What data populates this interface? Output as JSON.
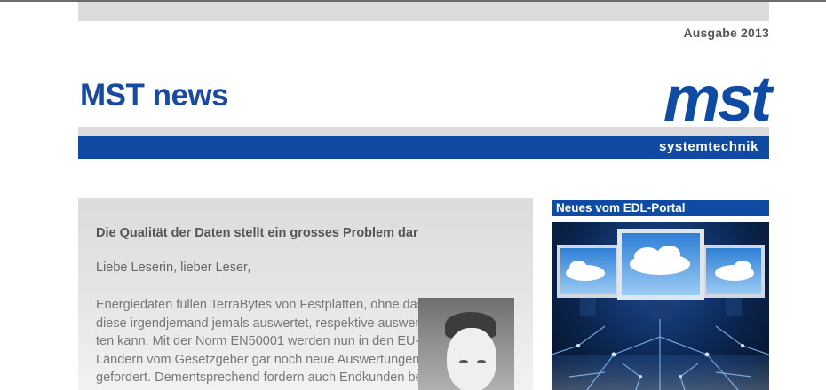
{
  "header": {
    "edition": "Ausgabe 2013",
    "title": "MST news"
  },
  "logo": {
    "word": "mst",
    "subtitle": "systemtechnik"
  },
  "article": {
    "headline": "Die Qualität der Daten stellt ein grosses Problem dar",
    "salutation": "Liebe Leserin, lieber Leser,",
    "lines": [
      "Energiedaten füllen TerraBytes von Festplatten, ohne dass",
      "diese irgendjemand jemals auswertet, respektive auswer-",
      "ten kann. Mit der Norm EN50001 werden nun in den EU-",
      "Ländern vom Gesetzgeber gar noch neue Auswertungen",
      "gefordert. Dementsprechend fordern auch Endkunden be-"
    ]
  },
  "sidebar": {
    "title": "Neues vom EDL-Portal"
  },
  "colors": {
    "brand_blue": "#0f4ba3",
    "band_grey": "#dcdcdc"
  }
}
